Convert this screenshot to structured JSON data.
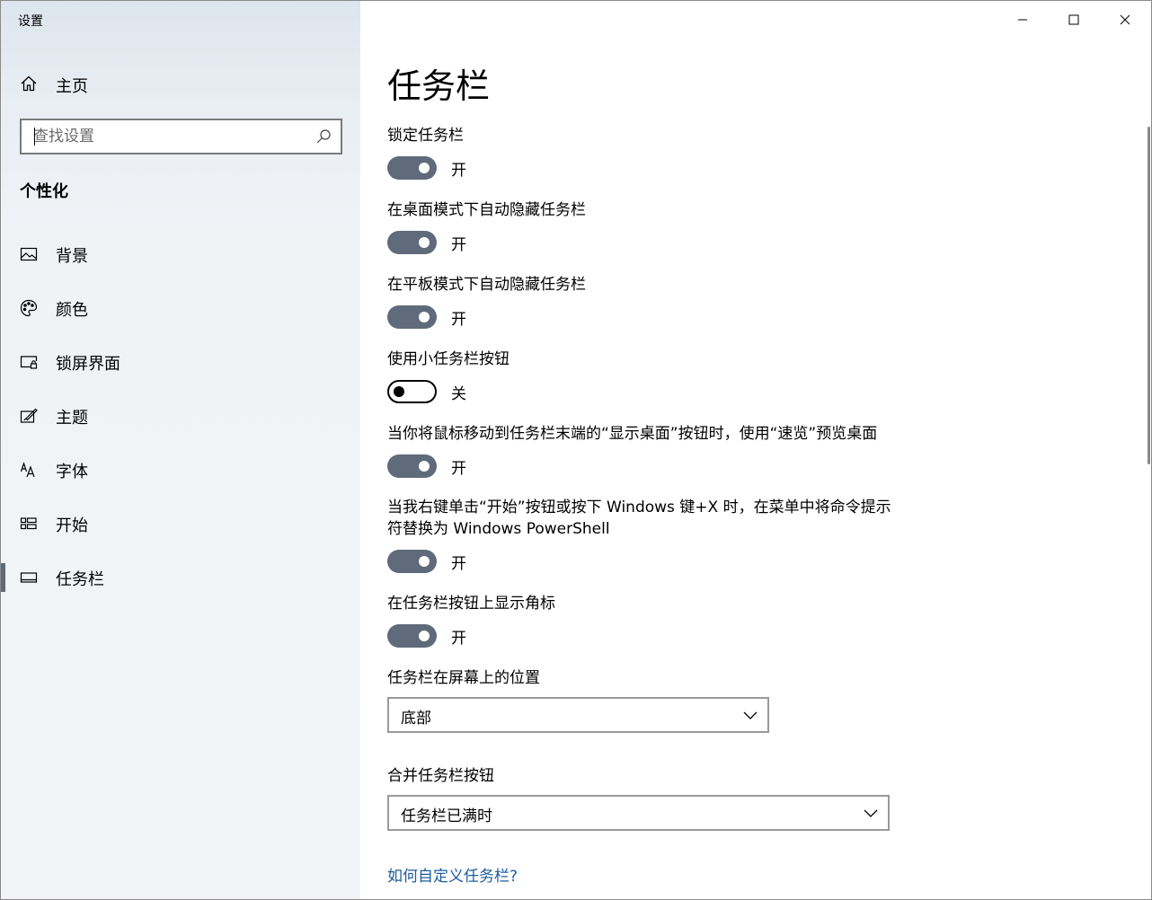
{
  "window": {
    "title": "设置"
  },
  "sidebar": {
    "home_label": "主页",
    "search": {
      "placeholder": "查找设置",
      "value": ""
    },
    "section_title": "个性化",
    "items": [
      {
        "label": "背景",
        "icon": "picture-icon",
        "active": false
      },
      {
        "label": "颜色",
        "icon": "palette-icon",
        "active": false
      },
      {
        "label": "锁屏界面",
        "icon": "lock-screen-icon",
        "active": false
      },
      {
        "label": "主题",
        "icon": "theme-brush-icon",
        "active": false
      },
      {
        "label": "字体",
        "icon": "font-icon",
        "active": false
      },
      {
        "label": "开始",
        "icon": "start-tiles-icon",
        "active": false
      },
      {
        "label": "任务栏",
        "icon": "taskbar-icon",
        "active": true
      }
    ]
  },
  "main": {
    "title": "任务栏",
    "settings": [
      {
        "label": "锁定任务栏",
        "on": true,
        "state_text": "开"
      },
      {
        "label": "在桌面模式下自动隐藏任务栏",
        "on": true,
        "state_text": "开"
      },
      {
        "label": "在平板模式下自动隐藏任务栏",
        "on": true,
        "state_text": "开"
      },
      {
        "label": "使用小任务栏按钮",
        "on": false,
        "state_text": "关"
      },
      {
        "label": "当你将鼠标移动到任务栏末端的“显示桌面”按钮时，使用“速览”预览桌面",
        "on": true,
        "state_text": "开"
      },
      {
        "label": "当我右键单击“开始”按钮或按下 Windows 键+X 时，在菜单中将命令提示符替换为 Windows PowerShell",
        "on": true,
        "state_text": "开"
      },
      {
        "label": "在任务栏按钮上显示角标",
        "on": true,
        "state_text": "开"
      }
    ],
    "position_dropdown": {
      "label": "任务栏在屏幕上的位置",
      "value": "底部"
    },
    "combine_dropdown": {
      "label": "合并任务栏按钮",
      "value": "任务栏已满时"
    },
    "help_link": "如何自定义任务栏?"
  },
  "colors": {
    "toggle_on": "#5f6b7a",
    "link": "#1b5c9e",
    "active_indicator": "#5f6b7a"
  }
}
